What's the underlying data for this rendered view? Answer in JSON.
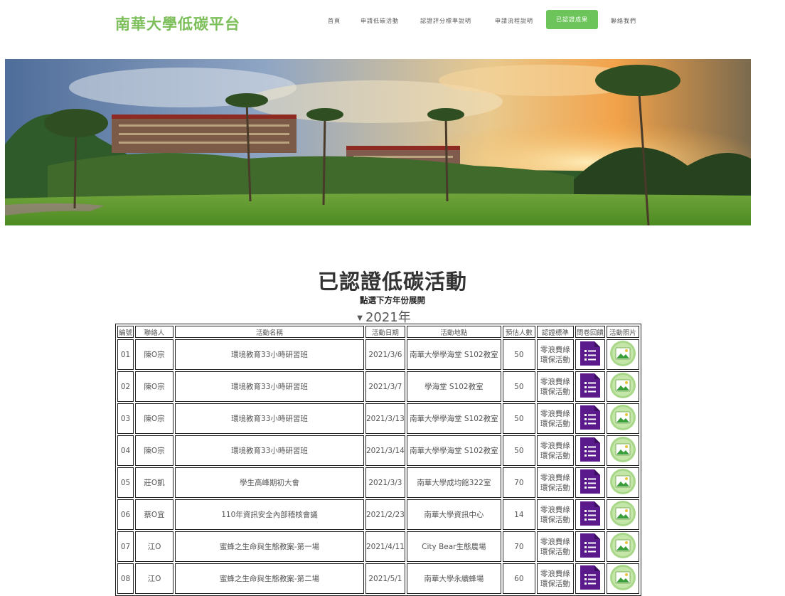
{
  "site": {
    "title": "南華大學低碳平台"
  },
  "nav": {
    "items": [
      {
        "label": "首頁",
        "active": false
      },
      {
        "label": "申請低碳活動",
        "active": false
      },
      {
        "label": "認證評分標準說明",
        "active": false
      },
      {
        "label": "申請流程說明",
        "active": false
      },
      {
        "label": "已認證成果",
        "active": true
      },
      {
        "label": "聯絡我們",
        "active": false
      }
    ]
  },
  "page": {
    "title": "已認證低碳活動",
    "subtitle": "點選下方年份展開",
    "year": "2021年"
  },
  "colors": {
    "brand_green": "#7cbf5a",
    "nav_active_bg": "#6cc45a",
    "form_icon": "#5b1a8b",
    "photo_icon": "#a9d88a"
  },
  "table": {
    "headers": [
      "編號",
      "聯絡人",
      "活動名稱",
      "活動日期",
      "活動地點",
      "預估人數",
      "認證標準",
      "問卷回饋",
      "活動照片"
    ],
    "rows": [
      {
        "no": "01",
        "contact": "陳O宗",
        "name": "環境教育33小時研習班",
        "date": "2021/3/6",
        "place": "南華大學學海堂 S102教室",
        "people": "50",
        "cert1": "零浪費綠",
        "cert2": "環保活動"
      },
      {
        "no": "02",
        "contact": "陳O宗",
        "name": "環境教育33小時研習班",
        "date": "2021/3/7",
        "place": "學海堂 S102教室",
        "people": "50",
        "cert1": "零浪費綠",
        "cert2": "環保活動"
      },
      {
        "no": "03",
        "contact": "陳O宗",
        "name": "環境教育33小時研習班",
        "date": "2021/3/13",
        "place": "南華大學學海堂 S102教室",
        "people": "50",
        "cert1": "零浪費綠",
        "cert2": "環保活動"
      },
      {
        "no": "04",
        "contact": "陳O宗",
        "name": "環境教育33小時研習班",
        "date": "2021/3/14",
        "place": "南華大學學海堂 S102教室",
        "people": "50",
        "cert1": "零浪費綠",
        "cert2": "環保活動"
      },
      {
        "no": "05",
        "contact": "莊O凱",
        "name": "學生高峰期初大會",
        "date": "2021/3/3",
        "place": "南華大學成均館322室",
        "people": "70",
        "cert1": "零浪費綠",
        "cert2": "環保活動"
      },
      {
        "no": "06",
        "contact": "蔡O宜",
        "name": "110年資訊安全內部稽核會議",
        "date": "2021/2/23",
        "place": "南華大學資訊中心",
        "people": "14",
        "cert1": "零浪費綠",
        "cert2": "環保活動"
      },
      {
        "no": "07",
        "contact": "江O",
        "name": "蜜蜂之生命與生態教案-第一場",
        "date": "2021/4/11",
        "place": "City Bear生態農場",
        "people": "70",
        "cert1": "零浪費綠",
        "cert2": "環保活動"
      },
      {
        "no": "08",
        "contact": "江O",
        "name": "蜜蜂之生命與生態教案-第二場",
        "date": "2021/5/1",
        "place": "南華大學永續蜂場",
        "people": "60",
        "cert1": "零浪費綠",
        "cert2": "環保活動"
      }
    ]
  }
}
